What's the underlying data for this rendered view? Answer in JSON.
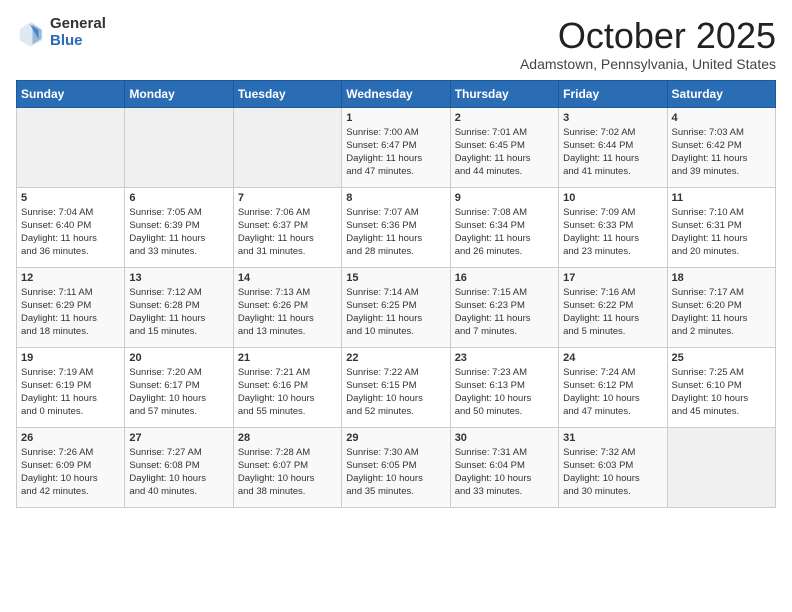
{
  "logo": {
    "general": "General",
    "blue": "Blue"
  },
  "title": "October 2025",
  "location": "Adamstown, Pennsylvania, United States",
  "days_of_week": [
    "Sunday",
    "Monday",
    "Tuesday",
    "Wednesday",
    "Thursday",
    "Friday",
    "Saturday"
  ],
  "weeks": [
    [
      {
        "day": "",
        "info": ""
      },
      {
        "day": "",
        "info": ""
      },
      {
        "day": "",
        "info": ""
      },
      {
        "day": "1",
        "info": "Sunrise: 7:00 AM\nSunset: 6:47 PM\nDaylight: 11 hours\nand 47 minutes."
      },
      {
        "day": "2",
        "info": "Sunrise: 7:01 AM\nSunset: 6:45 PM\nDaylight: 11 hours\nand 44 minutes."
      },
      {
        "day": "3",
        "info": "Sunrise: 7:02 AM\nSunset: 6:44 PM\nDaylight: 11 hours\nand 41 minutes."
      },
      {
        "day": "4",
        "info": "Sunrise: 7:03 AM\nSunset: 6:42 PM\nDaylight: 11 hours\nand 39 minutes."
      }
    ],
    [
      {
        "day": "5",
        "info": "Sunrise: 7:04 AM\nSunset: 6:40 PM\nDaylight: 11 hours\nand 36 minutes."
      },
      {
        "day": "6",
        "info": "Sunrise: 7:05 AM\nSunset: 6:39 PM\nDaylight: 11 hours\nand 33 minutes."
      },
      {
        "day": "7",
        "info": "Sunrise: 7:06 AM\nSunset: 6:37 PM\nDaylight: 11 hours\nand 31 minutes."
      },
      {
        "day": "8",
        "info": "Sunrise: 7:07 AM\nSunset: 6:36 PM\nDaylight: 11 hours\nand 28 minutes."
      },
      {
        "day": "9",
        "info": "Sunrise: 7:08 AM\nSunset: 6:34 PM\nDaylight: 11 hours\nand 26 minutes."
      },
      {
        "day": "10",
        "info": "Sunrise: 7:09 AM\nSunset: 6:33 PM\nDaylight: 11 hours\nand 23 minutes."
      },
      {
        "day": "11",
        "info": "Sunrise: 7:10 AM\nSunset: 6:31 PM\nDaylight: 11 hours\nand 20 minutes."
      }
    ],
    [
      {
        "day": "12",
        "info": "Sunrise: 7:11 AM\nSunset: 6:29 PM\nDaylight: 11 hours\nand 18 minutes."
      },
      {
        "day": "13",
        "info": "Sunrise: 7:12 AM\nSunset: 6:28 PM\nDaylight: 11 hours\nand 15 minutes."
      },
      {
        "day": "14",
        "info": "Sunrise: 7:13 AM\nSunset: 6:26 PM\nDaylight: 11 hours\nand 13 minutes."
      },
      {
        "day": "15",
        "info": "Sunrise: 7:14 AM\nSunset: 6:25 PM\nDaylight: 11 hours\nand 10 minutes."
      },
      {
        "day": "16",
        "info": "Sunrise: 7:15 AM\nSunset: 6:23 PM\nDaylight: 11 hours\nand 7 minutes."
      },
      {
        "day": "17",
        "info": "Sunrise: 7:16 AM\nSunset: 6:22 PM\nDaylight: 11 hours\nand 5 minutes."
      },
      {
        "day": "18",
        "info": "Sunrise: 7:17 AM\nSunset: 6:20 PM\nDaylight: 11 hours\nand 2 minutes."
      }
    ],
    [
      {
        "day": "19",
        "info": "Sunrise: 7:19 AM\nSunset: 6:19 PM\nDaylight: 11 hours\nand 0 minutes."
      },
      {
        "day": "20",
        "info": "Sunrise: 7:20 AM\nSunset: 6:17 PM\nDaylight: 10 hours\nand 57 minutes."
      },
      {
        "day": "21",
        "info": "Sunrise: 7:21 AM\nSunset: 6:16 PM\nDaylight: 10 hours\nand 55 minutes."
      },
      {
        "day": "22",
        "info": "Sunrise: 7:22 AM\nSunset: 6:15 PM\nDaylight: 10 hours\nand 52 minutes."
      },
      {
        "day": "23",
        "info": "Sunrise: 7:23 AM\nSunset: 6:13 PM\nDaylight: 10 hours\nand 50 minutes."
      },
      {
        "day": "24",
        "info": "Sunrise: 7:24 AM\nSunset: 6:12 PM\nDaylight: 10 hours\nand 47 minutes."
      },
      {
        "day": "25",
        "info": "Sunrise: 7:25 AM\nSunset: 6:10 PM\nDaylight: 10 hours\nand 45 minutes."
      }
    ],
    [
      {
        "day": "26",
        "info": "Sunrise: 7:26 AM\nSunset: 6:09 PM\nDaylight: 10 hours\nand 42 minutes."
      },
      {
        "day": "27",
        "info": "Sunrise: 7:27 AM\nSunset: 6:08 PM\nDaylight: 10 hours\nand 40 minutes."
      },
      {
        "day": "28",
        "info": "Sunrise: 7:28 AM\nSunset: 6:07 PM\nDaylight: 10 hours\nand 38 minutes."
      },
      {
        "day": "29",
        "info": "Sunrise: 7:30 AM\nSunset: 6:05 PM\nDaylight: 10 hours\nand 35 minutes."
      },
      {
        "day": "30",
        "info": "Sunrise: 7:31 AM\nSunset: 6:04 PM\nDaylight: 10 hours\nand 33 minutes."
      },
      {
        "day": "31",
        "info": "Sunrise: 7:32 AM\nSunset: 6:03 PM\nDaylight: 10 hours\nand 30 minutes."
      },
      {
        "day": "",
        "info": ""
      }
    ]
  ]
}
